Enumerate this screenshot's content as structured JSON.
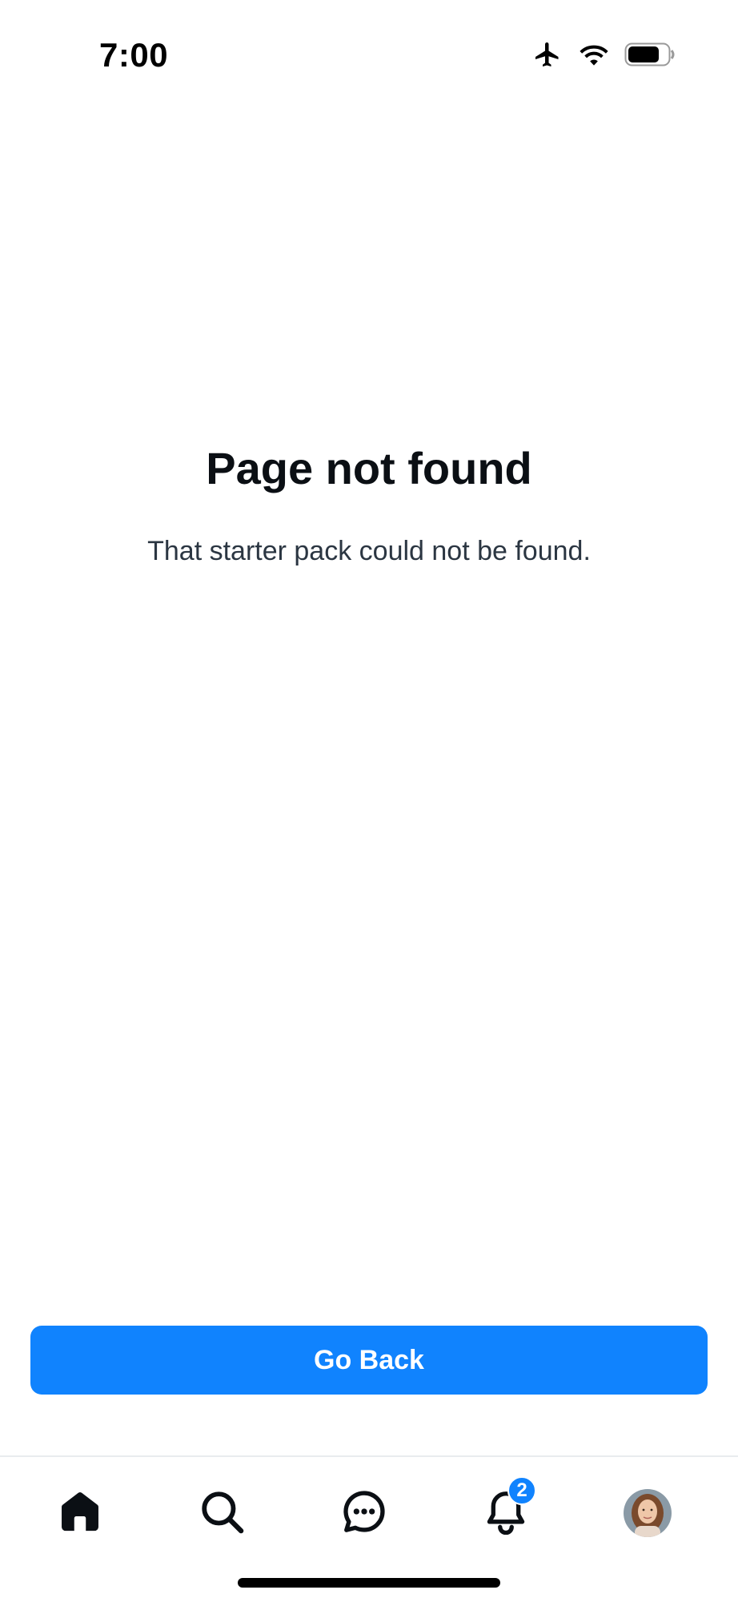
{
  "status_bar": {
    "time": "7:00",
    "icons": [
      "airplane-icon",
      "wifi-icon",
      "battery-icon"
    ]
  },
  "main": {
    "title": "Page not found",
    "message": "That starter pack could not be found."
  },
  "actions": {
    "go_back_label": "Go Back"
  },
  "bottom_nav": {
    "items": [
      {
        "icon": "home-icon",
        "active": true
      },
      {
        "icon": "search-icon",
        "active": false
      },
      {
        "icon": "chat-icon",
        "active": false
      },
      {
        "icon": "bell-icon",
        "active": false,
        "badge": "2"
      },
      {
        "icon": "avatar",
        "active": false
      }
    ]
  },
  "colors": {
    "accent": "#1083fe",
    "text_primary": "#0b0f14",
    "text_secondary": "#2b3642",
    "divider": "#e9ecef"
  }
}
